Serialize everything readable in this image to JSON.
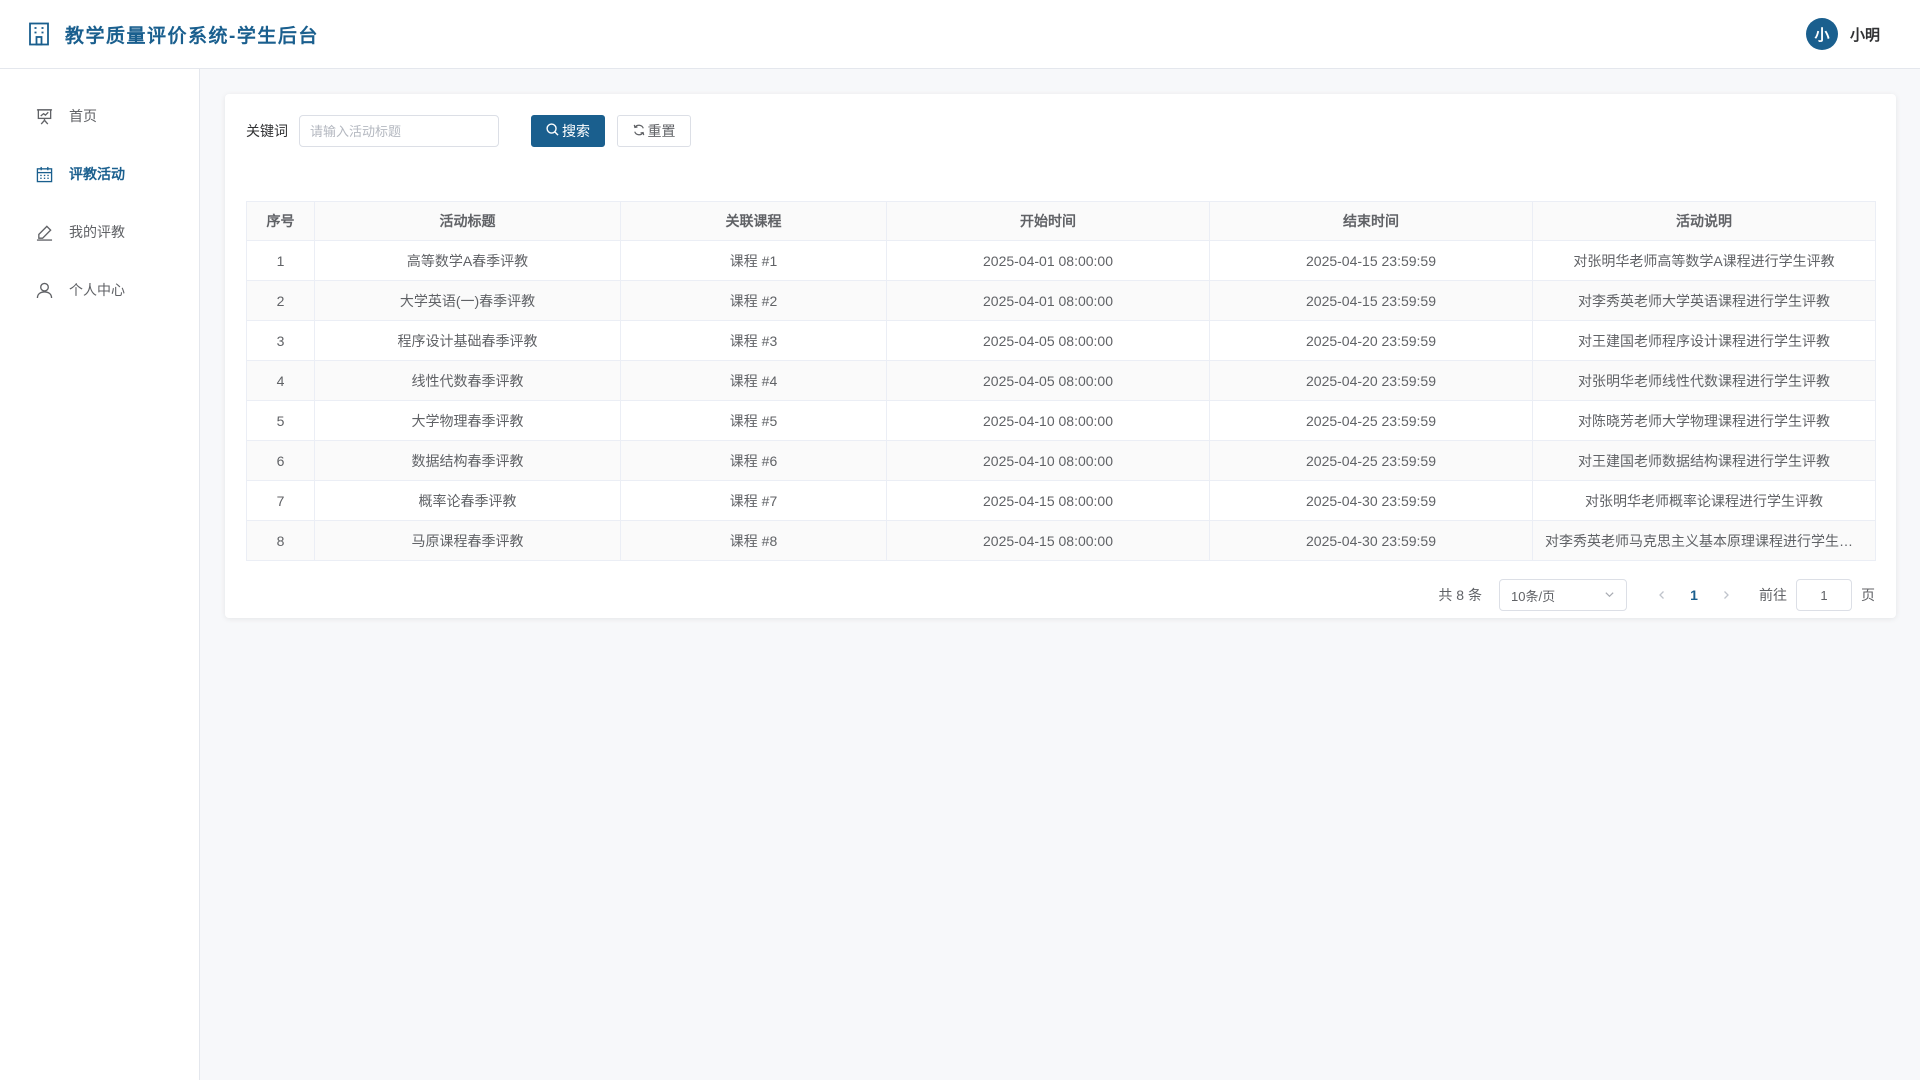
{
  "header": {
    "title": "教学质量评价系统-学生后台",
    "avatar_text": "小",
    "username": "小明",
    "accent_color": "#1a5f8e"
  },
  "sidebar": {
    "items": [
      {
        "label": "首页",
        "icon": "presentation-board-icon",
        "active": false
      },
      {
        "label": "评教活动",
        "icon": "calendar-icon",
        "active": true
      },
      {
        "label": "我的评教",
        "icon": "edit-pen-icon",
        "active": false
      },
      {
        "label": "个人中心",
        "icon": "user-icon",
        "active": false
      }
    ]
  },
  "filter": {
    "keyword_label": "关键词",
    "keyword_value": "",
    "keyword_placeholder": "请输入活动标题",
    "search_label": "搜索",
    "reset_label": "重置"
  },
  "table": {
    "columns": [
      "序号",
      "活动标题",
      "关联课程",
      "开始时间",
      "结束时间",
      "活动说明"
    ],
    "rows": [
      [
        "1",
        "高等数学A春季评教",
        "课程 #1",
        "2025-04-01 08:00:00",
        "2025-04-15 23:59:59",
        "对张明华老师高等数学A课程进行学生评教"
      ],
      [
        "2",
        "大学英语(一)春季评教",
        "课程 #2",
        "2025-04-01 08:00:00",
        "2025-04-15 23:59:59",
        "对李秀英老师大学英语课程进行学生评教"
      ],
      [
        "3",
        "程序设计基础春季评教",
        "课程 #3",
        "2025-04-05 08:00:00",
        "2025-04-20 23:59:59",
        "对王建国老师程序设计课程进行学生评教"
      ],
      [
        "4",
        "线性代数春季评教",
        "课程 #4",
        "2025-04-05 08:00:00",
        "2025-04-20 23:59:59",
        "对张明华老师线性代数课程进行学生评教"
      ],
      [
        "5",
        "大学物理春季评教",
        "课程 #5",
        "2025-04-10 08:00:00",
        "2025-04-25 23:59:59",
        "对陈晓芳老师大学物理课程进行学生评教"
      ],
      [
        "6",
        "数据结构春季评教",
        "课程 #6",
        "2025-04-10 08:00:00",
        "2025-04-25 23:59:59",
        "对王建国老师数据结构课程进行学生评教"
      ],
      [
        "7",
        "概率论春季评教",
        "课程 #7",
        "2025-04-15 08:00:00",
        "2025-04-30 23:59:59",
        "对张明华老师概率论课程进行学生评教"
      ],
      [
        "8",
        "马原课程春季评教",
        "课程 #8",
        "2025-04-15 08:00:00",
        "2025-04-30 23:59:59",
        "对李秀英老师马克思主义基本原理课程进行学生评教"
      ]
    ]
  },
  "pagination": {
    "total_text": "共 8 条",
    "page_size": "10条/页",
    "current_page": "1",
    "goto_label": "前往",
    "goto_value": "1",
    "page_unit": "页"
  }
}
